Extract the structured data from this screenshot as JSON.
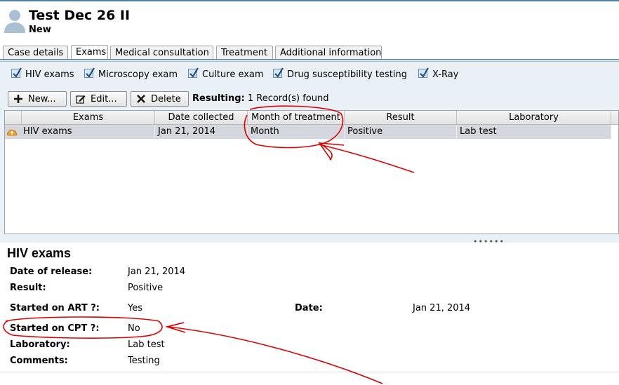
{
  "header": {
    "title": "Test Dec 26 II",
    "status": "New"
  },
  "tabs": [
    {
      "label": "Case details",
      "active": false
    },
    {
      "label": "Exams",
      "active": true
    },
    {
      "label": "Medical consultation",
      "active": false
    },
    {
      "label": "Treatment",
      "active": false
    },
    {
      "label": "Additional information",
      "active": false
    }
  ],
  "filters": [
    {
      "label": "HIV exams",
      "checked": true
    },
    {
      "label": "Microscopy exam",
      "checked": true
    },
    {
      "label": "Culture exam",
      "checked": true
    },
    {
      "label": "Drug susceptibility testing",
      "checked": true
    },
    {
      "label": "X-Ray",
      "checked": true
    }
  ],
  "toolbar": {
    "new_label": "New...",
    "edit_label": "Edit...",
    "delete_label": "Delete",
    "resulting_label": "Resulting:",
    "resulting_value": "1 Record(s) found"
  },
  "grid": {
    "columns": [
      "Exams",
      "Date collected",
      "Month of treatment",
      "Result",
      "Laboratory"
    ],
    "rows": [
      {
        "exam": "HIV exams",
        "date_collected": "Jan 21, 2014",
        "month_of_treatment": "Month",
        "result": "Positive",
        "laboratory": "Lab test"
      }
    ]
  },
  "detail": {
    "title": "HIV exams",
    "fields": {
      "date_of_release_label": "Date of release:",
      "date_of_release_value": "Jan 21, 2014",
      "result_label": "Result:",
      "result_value": "Positive",
      "started_art_label": "Started on ART ?:",
      "started_art_value": "Yes",
      "date_label": "Date:",
      "date_value": "Jan 21, 2014",
      "started_cpt_label": "Started on CPT ?:",
      "started_cpt_value": "No",
      "laboratory_label": "Laboratory:",
      "laboratory_value": "Lab test",
      "comments_label": "Comments:",
      "comments_value": "Testing"
    }
  },
  "colors": {
    "accent": "#4f7fa8",
    "panel": "#e9f0f6",
    "selected_row": "#d4d8de",
    "annotation": "#e00000"
  }
}
